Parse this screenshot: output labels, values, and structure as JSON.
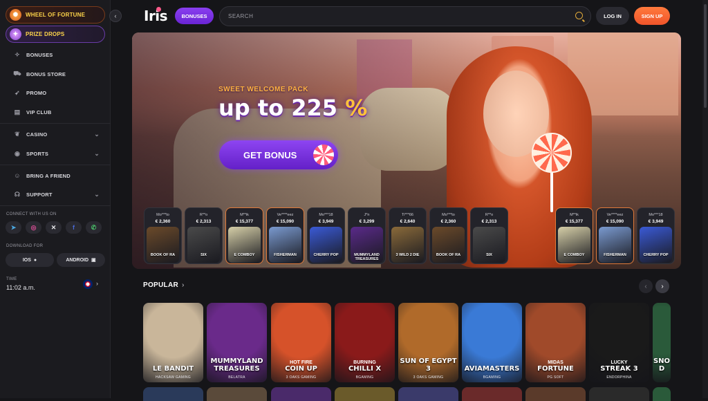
{
  "sidebar": {
    "promos": [
      {
        "label": "WHEEL OF FORTUNE",
        "icon": "wheel-icon"
      },
      {
        "label": "PRIZE DROPS",
        "icon": "gift-icon"
      }
    ],
    "items": [
      {
        "label": "BONUSES",
        "icon": "gift-icon"
      },
      {
        "label": "BONUS STORE",
        "icon": "cart-icon"
      },
      {
        "label": "PROMO",
        "icon": "rocket-icon"
      },
      {
        "label": "VIP CLUB",
        "icon": "building-icon"
      },
      {
        "label": "CASINO",
        "icon": "cherry-icon"
      },
      {
        "label": "SPORTS",
        "icon": "ball-icon"
      },
      {
        "label": "BRING A FRIEND",
        "icon": "people-icon"
      },
      {
        "label": "SUPPORT",
        "icon": "headset-icon"
      }
    ],
    "connect_label": "CONNECT WITH US ON",
    "socials": [
      "telegram-icon",
      "instagram-icon",
      "x-icon",
      "facebook-icon",
      "whatsapp-icon"
    ],
    "download_label": "DOWNLOAD FOR",
    "downloads": [
      {
        "label": "IOS",
        "icon": "apple-icon"
      },
      {
        "label": "ANDROID",
        "icon": "android-icon"
      }
    ],
    "time_label": "TIME",
    "time_value": "11:02 a.m."
  },
  "header": {
    "logo": "Iris",
    "bonuses_label": "BONUSES",
    "search_placeholder": "SEARCH",
    "login_label": "LOG IN",
    "signup_label": "SIGN UP"
  },
  "hero": {
    "kicker": "SWEET WELCOME PACK",
    "headline": "up to 225",
    "headline_pct": "%",
    "cta": "GET BONUS"
  },
  "wins": [
    {
      "user": "Mo***to",
      "amount": "€ 2,360",
      "game": "BOOK OF RA",
      "color": "#6b4a2a",
      "hot": false
    },
    {
      "user": "R**o",
      "amount": "€ 2,313",
      "game": "SIX",
      "color": "#4a4a4a",
      "hot": false
    },
    {
      "user": "M**ik",
      "amount": "€ 15,377",
      "game": "E COMBOY",
      "color": "#d6cfa8",
      "hot": true
    },
    {
      "user": "Ve****eez",
      "amount": "€ 15,090",
      "game": "FISHERMAN",
      "color": "#7a9ad0",
      "hot": true
    },
    {
      "user": "Mo***18",
      "amount": "€ 3,949",
      "game": "CHERRY POP",
      "color": "#3a5ad6",
      "hot": false
    },
    {
      "user": "J*n",
      "amount": "€ 3,299",
      "game": "MUMMYLAND TREASURES",
      "color": "#5a2a8a",
      "hot": false
    },
    {
      "user": "Ti***66",
      "amount": "€ 2,640",
      "game": "3 WILD 2 DIE",
      "color": "#8a6a3a",
      "hot": false
    },
    {
      "user": "Mo***to",
      "amount": "€ 2,360",
      "game": "BOOK OF RA",
      "color": "#6b4a2a",
      "hot": false
    },
    {
      "user": "R**o",
      "amount": "€ 2,313",
      "game": "SIX",
      "color": "#4a4a4a",
      "hot": false
    },
    {
      "user": "M**ik",
      "amount": "€ 15,377",
      "game": "E COMBOY",
      "color": "#d6cfa8",
      "hot": true
    },
    {
      "user": "Ve****eez",
      "amount": "€ 15,090",
      "game": "FISHERMAN",
      "color": "#7a9ad0",
      "hot": true
    },
    {
      "user": "Mo***18",
      "amount": "€ 3,949",
      "game": "CHERRY POP",
      "color": "#3a5ad6",
      "hot": false
    }
  ],
  "popular": {
    "title": "POPULAR",
    "games": [
      {
        "title": "LE BANDIT",
        "sub": "",
        "provider": "HACKSAW GAMING",
        "bg": "#c9b69a"
      },
      {
        "title": "MUMMYLAND TREASURES",
        "sub": "",
        "provider": "BELATRA",
        "bg": "#6a2a8a"
      },
      {
        "title": "COIN UP",
        "sub": "HOT FIRE",
        "provider": "3 OAKS GAMING",
        "bg": "#d6522a"
      },
      {
        "title": "CHILLI X",
        "sub": "BURNING",
        "provider": "BGAMING",
        "bg": "#8a1a1a"
      },
      {
        "title": "SUN OF EGYPT 3",
        "sub": "",
        "provider": "3 OAKS GAMING",
        "bg": "#b06a2a"
      },
      {
        "title": "AVIAMASTERS",
        "sub": "",
        "provider": "BGAMING",
        "bg": "#3a7ad6"
      },
      {
        "title": "FORTUNE",
        "sub": "MIDAS",
        "provider": "PG SOFT",
        "bg": "#a04a2a"
      },
      {
        "title": "STREAK 3",
        "sub": "LUCKY",
        "provider": "ENDORPHINA",
        "bg": "#1a1a1a"
      },
      {
        "title": "SNO D",
        "sub": "",
        "provider": "",
        "bg": "#2a5a3a"
      }
    ]
  },
  "colors": {
    "accent": "#7a35e6",
    "signup": "#f0542a",
    "gold": "#ffc23a"
  }
}
